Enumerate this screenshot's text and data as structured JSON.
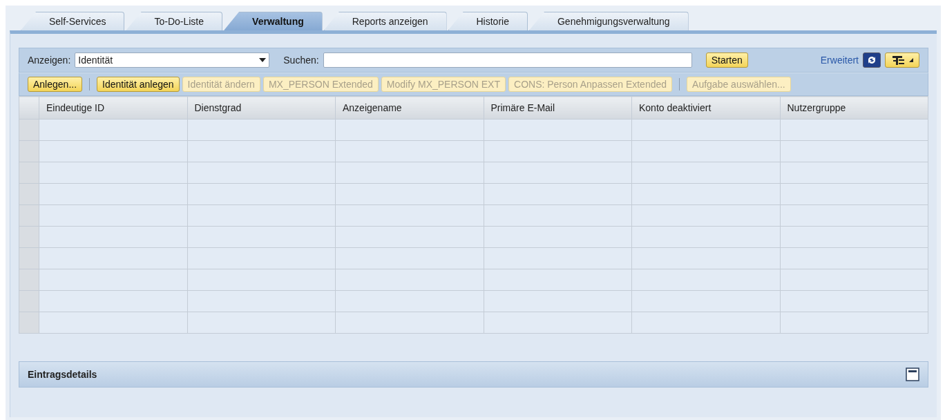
{
  "tabs": [
    {
      "label": "Self-Services",
      "selected": false
    },
    {
      "label": "To-Do-Liste",
      "selected": false
    },
    {
      "label": "Verwaltung",
      "selected": true
    },
    {
      "label": "Reports anzeigen",
      "selected": false
    },
    {
      "label": "Historie",
      "selected": false
    },
    {
      "label": "Genehmigungsverwaltung",
      "selected": false
    }
  ],
  "search_bar": {
    "show_label": "Anzeigen:",
    "show_value": "Identität",
    "search_label": "Suchen:",
    "start_button": "Starten",
    "advanced_link": "Erweitert"
  },
  "actions": [
    {
      "kind": "button",
      "label": "Anlegen...",
      "disabled": false
    },
    {
      "kind": "separator"
    },
    {
      "kind": "button",
      "label": "Identität anlegen",
      "disabled": false
    },
    {
      "kind": "button",
      "label": "Identität ändern",
      "disabled": true
    },
    {
      "kind": "button",
      "label": "MX_PERSON Extended",
      "disabled": true
    },
    {
      "kind": "button",
      "label": "Modify MX_PERSON EXT",
      "disabled": true
    },
    {
      "kind": "button",
      "label": "CONS: Person Anpassen Extended",
      "disabled": true
    },
    {
      "kind": "separator"
    },
    {
      "kind": "button",
      "label": "Aufgabe auswählen...",
      "disabled": true
    }
  ],
  "table": {
    "columns": [
      "Eindeutige ID",
      "Dienstgrad",
      "Anzeigename",
      "Primäre E-Mail",
      "Konto deaktiviert",
      "Nutzergruppe"
    ]
  },
  "details_panel": {
    "title": "Eintragsdetails"
  }
}
